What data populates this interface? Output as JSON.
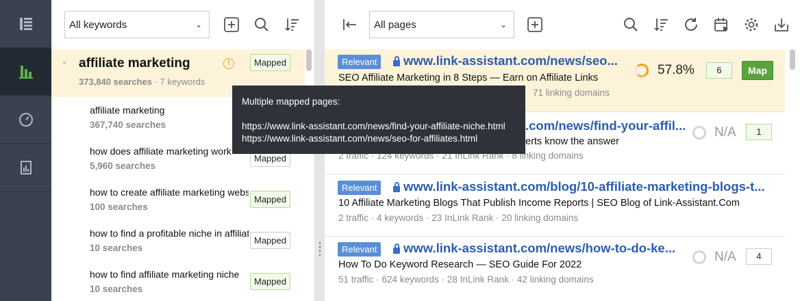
{
  "nav": {
    "items": [
      {
        "name": "list-icon",
        "active": false
      },
      {
        "name": "bar-chart-icon",
        "active": true
      },
      {
        "name": "gauge-icon",
        "active": false
      },
      {
        "name": "report-icon",
        "active": false
      }
    ]
  },
  "keywords_toolbar": {
    "filter_value": "All keywords",
    "icons": [
      "add-icon",
      "search-icon",
      "sort-icon"
    ]
  },
  "keyword_group": {
    "title": "affiliate marketing",
    "searches": "373,840 searches",
    "separator": " · ",
    "keyword_count": "7 keywords",
    "mapped_label": "Mapped",
    "warning": "!"
  },
  "keywords": [
    {
      "text": "affiliate marketing",
      "searches": "367,740 searches",
      "mapped": ""
    },
    {
      "text": "how does affiliate marketing work",
      "searches": "5,960 searches",
      "mapped": "Mapped"
    },
    {
      "text": "how to create affiliate marketing website",
      "searches": "100 searches",
      "mapped": "Mapped"
    },
    {
      "text": "how to find a profitable niche in affiliate marketing",
      "searches": "10 searches",
      "mapped": "Mapped"
    },
    {
      "text": "how to find affiliate marketing niche",
      "searches": "10 searches",
      "mapped": "Mapped"
    }
  ],
  "pages_toolbar": {
    "filter_value": "All pages",
    "icons": [
      "collapse-left-icon",
      "add-icon",
      "search-icon",
      "sort-icon",
      "refresh-icon",
      "schedule-icon",
      "settings-icon",
      "download-icon"
    ]
  },
  "pages": [
    {
      "badge": "Relevant",
      "url": "www.link-assistant.com/news/seo...",
      "title": "SEO Affiliate Marketing in 8 Steps — Earn on Affiliate Links",
      "stats": "71 linking domains",
      "score": "57.8%",
      "count": "6",
      "action": "Map"
    },
    {
      "badge": "Relevant",
      "url": ".com/news/find-your-affil...",
      "title": "erts know the answer",
      "stats": "2 traffic · 124 keywords · 21 InLink Rank · 8 linking domains",
      "score": "N/A",
      "count": "1",
      "action": ""
    },
    {
      "badge": "Relevant",
      "url": "www.link-assistant.com/blog/10-affiliate-marketing-blogs-t...",
      "title": "10 Affiliate Marketing Blogs That Publish Income Reports | SEO Blog of Link-Assistant.Com",
      "stats": "2 traffic · 4 keywords · 23 InLink Rank · 20 linking domains",
      "score": "",
      "count": "",
      "action": ""
    },
    {
      "badge": "Relevant",
      "url": "www.link-assistant.com/news/how-to-do-ke...",
      "title": "How To Do Keyword Research — SEO Guide For 2022",
      "stats": "51 traffic · 624 keywords · 28 InLink Rank · 42 linking domains",
      "score": "N/A",
      "count": "4",
      "action": ""
    }
  ],
  "tooltip": {
    "heading": "Multiple mapped pages:",
    "lines": [
      "https://www.link-assistant.com/news/find-your-affiliate-niche.html",
      "https://www.link-assistant.com/news/seo-for-affiliates.html"
    ]
  },
  "colors": {
    "accent_blue": "#2a5db0",
    "badge_blue": "#5a8fd8",
    "map_green": "#5aa33e",
    "highlight": "#fdf3d8",
    "rail": "#3a4250"
  }
}
